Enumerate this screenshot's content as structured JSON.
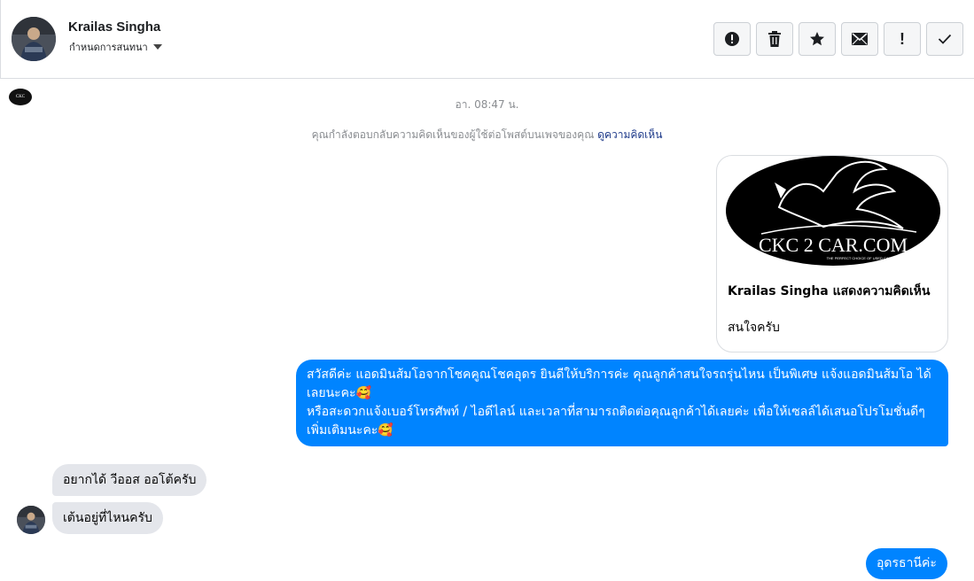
{
  "header": {
    "name": "Krailas Singha",
    "assign_label": "กำหนดการสนทนา",
    "toolbar": [
      {
        "id": "spam",
        "icon": "alert-circle-icon"
      },
      {
        "id": "delete",
        "icon": "trash-icon"
      },
      {
        "id": "star",
        "icon": "star-icon"
      },
      {
        "id": "unread",
        "icon": "envelope-icon"
      },
      {
        "id": "important",
        "icon": "exclamation-icon",
        "glyph": "!"
      },
      {
        "id": "done",
        "icon": "check-icon"
      }
    ]
  },
  "thread": {
    "timestamp": "อา. 08:47 น.",
    "info_text": "คุณกำลังตอบกลับความคิดเห็นของผู้ใช้ต่อโพสต์บนเพจของคุณ",
    "info_link": "ดูความคิดเห็น",
    "page_logo_text": "CKC",
    "comment_card": {
      "logo_main": "CKC 2 CAR.COM",
      "logo_sub": "THE PERFECT CHOICE OF USED CAR",
      "title": "Krailas Singha แสดงความคิดเห็น",
      "text": "สนใจครับ"
    },
    "outgoing_1": {
      "line1": "สวัสดีค่ะ แอดมินส้มโอจากโชคคูณโชคอุดร ยินดีให้บริการค่ะ   คุณลูกค้าสนใจรถรุ่นไหน เป็นพิเศษ แจ้งแอดมินส้มโอ ได้เลยนะคะ🥰",
      "line2": "หรือสะดวกแจ้งเบอร์โทรศัพท์ / ไอดีไลน์ และเวลาที่สามารถติดต่อคุณลูกค้าได้เลยค่ะ เพื่อให้เซลล์ได้เสนอโปรโมชั่นดีๆเพิ่มเติมนะคะ🥰"
    },
    "incoming_1": "อยากได้ วีออส ออโต้ครับ",
    "incoming_2": "เต้นอยู่ที่ไหนครับ",
    "outgoing_2": "อุดรธานีค่ะ"
  },
  "colors": {
    "outgoing_bubble": "#0084ff",
    "incoming_bubble": "#e4e6eb",
    "link": "#1e3a8a",
    "muted": "#8a8d91"
  }
}
